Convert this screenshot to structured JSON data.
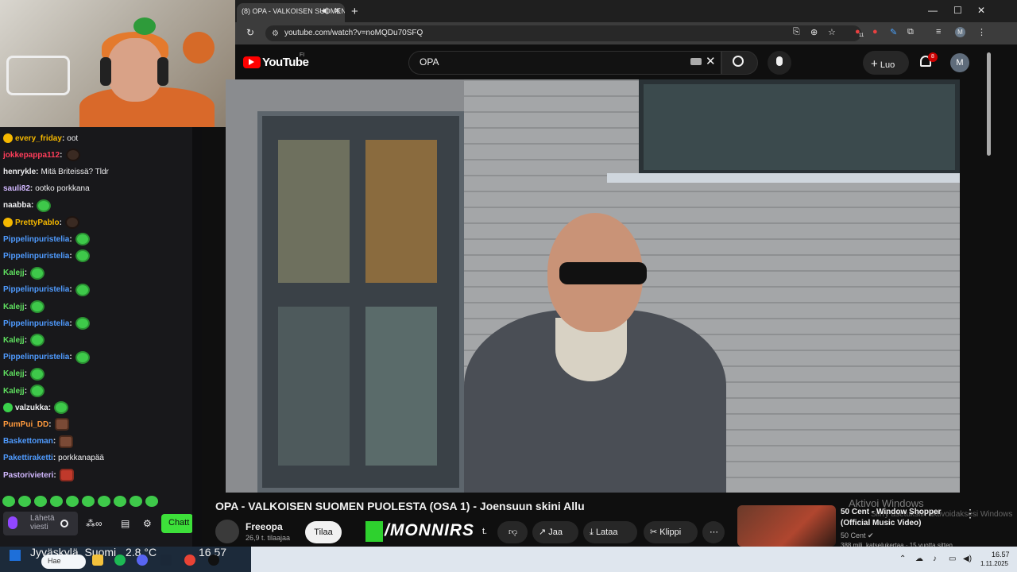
{
  "stream": {
    "chat": [
      {
        "user": "every_friday",
        "color": "#f5b800",
        "badge": "gold",
        "message": "oot",
        "emote": ""
      },
      {
        "user": "jokkepappa112",
        "color": "#ff3d5a",
        "badge": "",
        "message": "",
        "emote": "dark"
      },
      {
        "user": "henrykle",
        "color": "#efeff1",
        "badge": "",
        "message": "Mitä Briteissä? Tldr",
        "emote": ""
      },
      {
        "user": "sauli82",
        "color": "#d2b8ff",
        "badge": "",
        "message": "ootko porkkana",
        "emote": ""
      },
      {
        "user": "naabba",
        "color": "#efeff1",
        "badge": "",
        "message": "",
        "emote": "green"
      },
      {
        "user": "PrettyPablo",
        "color": "#f5b800",
        "badge": "gold",
        "message": "",
        "emote": "dark"
      },
      {
        "user": "Pippelinpuristelia",
        "color": "#4f9bff",
        "badge": "",
        "message": "",
        "emote": "green"
      },
      {
        "user": "Pippelinpuristelia",
        "color": "#4f9bff",
        "badge": "",
        "message": "",
        "emote": "green"
      },
      {
        "user": "Kalejj",
        "color": "#5fe05f",
        "badge": "",
        "message": "",
        "emote": "green"
      },
      {
        "user": "Pippelinpuristelia",
        "color": "#4f9bff",
        "badge": "",
        "message": "",
        "emote": "green"
      },
      {
        "user": "Kalejj",
        "color": "#5fe05f",
        "badge": "",
        "message": "",
        "emote": "green"
      },
      {
        "user": "Pippelinpuristelia",
        "color": "#4f9bff",
        "badge": "",
        "message": "",
        "emote": "green"
      },
      {
        "user": "Kalejj",
        "color": "#5fe05f",
        "badge": "",
        "message": "",
        "emote": "green"
      },
      {
        "user": "Pippelinpuristelia",
        "color": "#4f9bff",
        "badge": "",
        "message": "",
        "emote": "green"
      },
      {
        "user": "Kalejj",
        "color": "#5fe05f",
        "badge": "",
        "message": "",
        "emote": "green"
      },
      {
        "user": "Kalejj",
        "color": "#5fe05f",
        "badge": "",
        "message": "",
        "emote": "green"
      },
      {
        "user": "valzukka",
        "color": "#efeff1",
        "badge": "green",
        "message": "",
        "emote": "green"
      },
      {
        "user": "PumPui_DD",
        "color": "#ff9a3d",
        "badge": "",
        "message": "",
        "emote": "face"
      },
      {
        "user": "Baskettoman",
        "color": "#4f9bff",
        "badge": "",
        "message": "",
        "emote": "face"
      },
      {
        "user": "Pakettiraketti",
        "color": "#4f9bff",
        "badge": "",
        "message": "porkkanapää",
        "emote": ""
      },
      {
        "user": "Pastorivieteri",
        "color": "#d2b8ff",
        "badge": "",
        "message": "",
        "emote": "red"
      }
    ],
    "chat_input_placeholder": "Lähetä viesti",
    "chat_button": "Chatt"
  },
  "browser": {
    "tab_title": "(8) OPA - VALKOISEN SUOMEN",
    "url": "youtube.com/watch?v=noMQDu70SFQ",
    "extension_badge": "11"
  },
  "youtube": {
    "logo": "YouTube",
    "region": "FI",
    "search_value": "OPA",
    "create_label": "Luo",
    "notifications": "8",
    "avatar_letter": "M",
    "video_title": "OPA - VALKOISEN SUOMEN PUOLESTA (OSA 1) - Joensuun skini Allu",
    "channel_name": "Freeopa",
    "subscribers": "26,9 t. tilaajaa",
    "subscribe_label": "Tilaa",
    "overlay_brand": "/MONNIRS",
    "likes": "t.",
    "share_label": "Jaa",
    "download_label": "Lataa",
    "clip_label": "Klippi",
    "recommended": {
      "title": "50 Cent - Window Shopper (Official Music Video)",
      "channel": "50 Cent",
      "meta": "388 milj. katselukertaa · 15 vuotta sitten"
    },
    "watermark_title": "Aktivoi Windows",
    "watermark_sub": "Siirry asetuksiin aktivoidaksesi Windows"
  },
  "overlay": {
    "location": "Jyväskylä, Suomi",
    "temperature": "2.8 °C",
    "time": "16.57"
  },
  "taskbar": {
    "search_label": "Hae",
    "clock_time": "16.57",
    "clock_date": "1.11.2025"
  }
}
